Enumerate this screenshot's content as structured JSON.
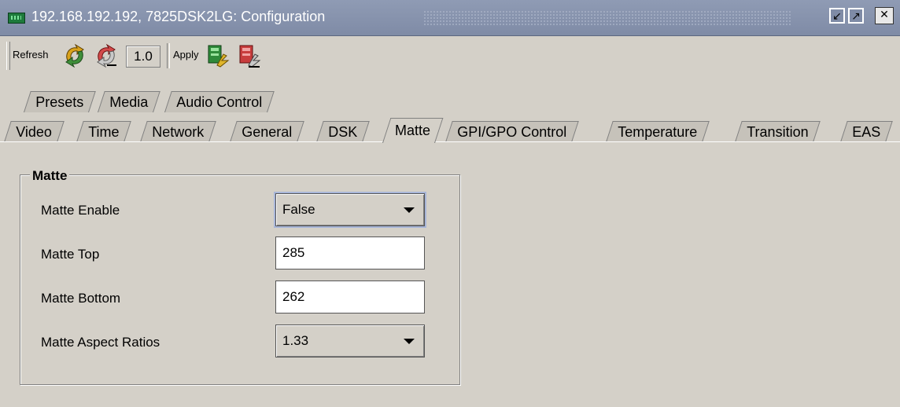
{
  "window": {
    "title": "192.168.192.192, 7825DSK2LG: Configuration",
    "controls": [
      "dock-icon",
      "float-icon",
      "close-icon"
    ]
  },
  "toolbar": {
    "refresh_label": "Refresh",
    "rate_value": "1.0",
    "apply_label": "Apply",
    "icons": [
      "refresh-icon",
      "refresh-stop-icon",
      "apply-icon",
      "apply-stop-icon"
    ]
  },
  "tabs": {
    "top_row": [
      "Presets",
      "Media",
      "Audio Control"
    ],
    "bottom_row": [
      "Video",
      "Time",
      "Network",
      "General",
      "DSK",
      "Matte",
      "GPI/GPO Control",
      "Temperature",
      "Transition",
      "EAS"
    ],
    "active": "Matte"
  },
  "matte": {
    "group_title": "Matte",
    "fields": [
      {
        "label": "Matte Enable",
        "value": "False",
        "type": "select"
      },
      {
        "label": "Matte Top",
        "value": "285",
        "type": "text"
      },
      {
        "label": "Matte Bottom",
        "value": "262",
        "type": "text"
      },
      {
        "label": "Matte Aspect Ratios",
        "value": "1.33",
        "type": "select"
      }
    ]
  },
  "colors": {
    "titlebar": "#8f9bb4",
    "panel": "#d4d0c8",
    "tab": "#c6c2ba"
  }
}
